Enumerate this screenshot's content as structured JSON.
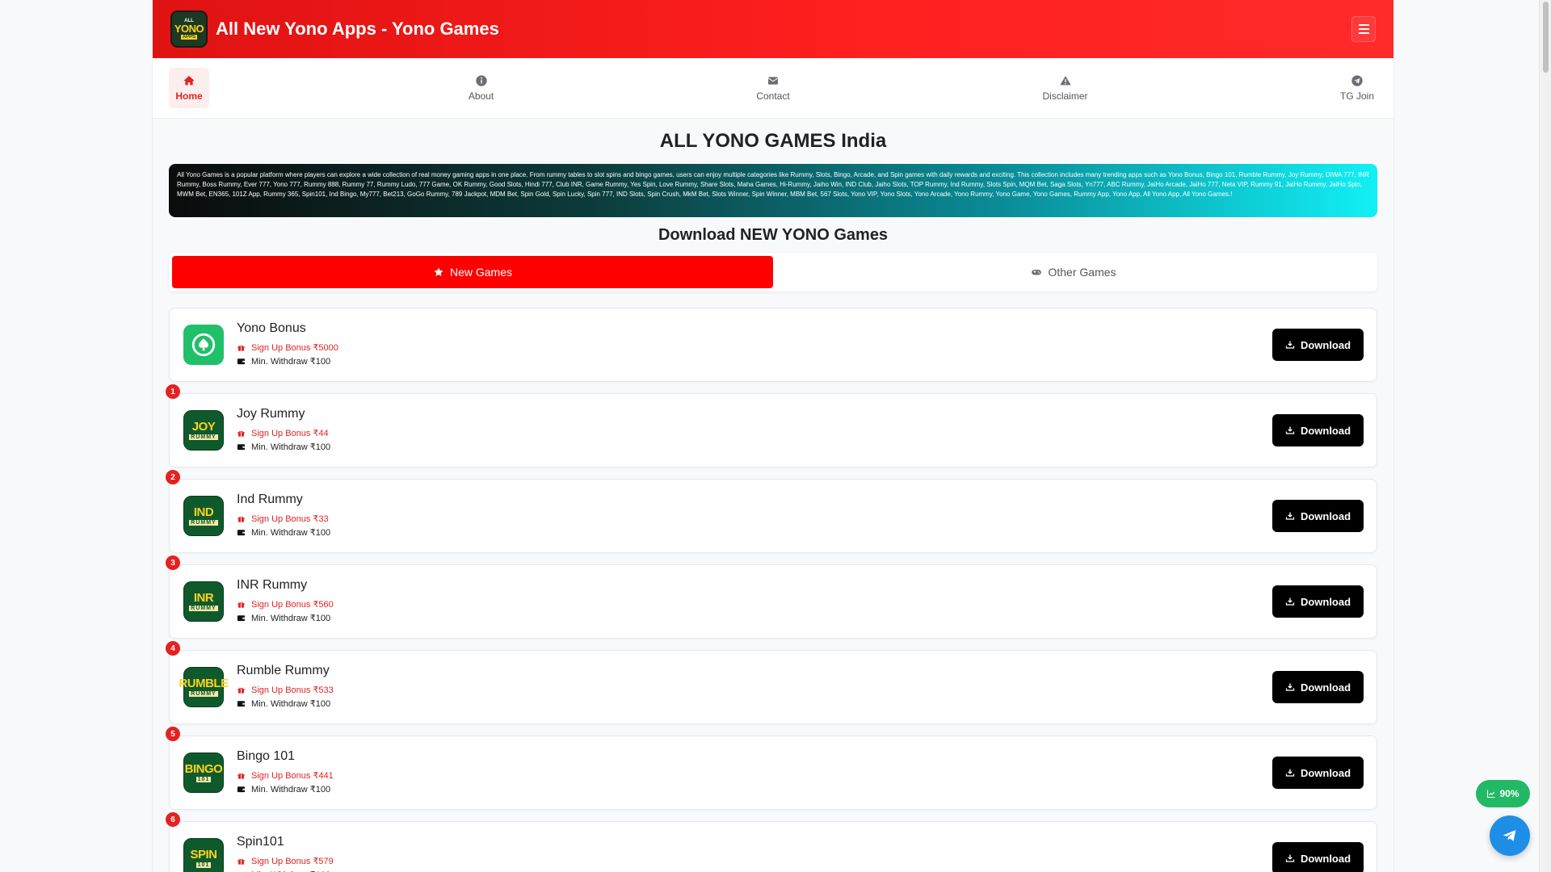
{
  "header": {
    "logo": {
      "top": "ALL",
      "mid": "YONO",
      "bottom": "APPS"
    },
    "title": "All New Yono Apps - Yono Games",
    "menu_icon": "hamburger-icon"
  },
  "nav": {
    "items": [
      {
        "label": "Home",
        "icon": "home-icon",
        "active": true
      },
      {
        "label": "About",
        "icon": "info-icon"
      },
      {
        "label": "Contact",
        "icon": "envelope-icon"
      },
      {
        "label": "Disclaimer",
        "icon": "warning-icon"
      },
      {
        "label": "TG Join",
        "icon": "telegram-icon"
      }
    ]
  },
  "main": {
    "heading": "ALL YONO GAMES India",
    "description": "All Yono Games is a popular platform where players can explore a wide collection of real money gaming apps in one place. From rummy tables to slot spins and bingo games, users can enjoy multiple categories like Rummy, Slots, Bingo, Arcade, and Spin games with daily rewards and exciting. This collection includes many trending apps such as Yono Bonus, Bingo 101, Rumble Rummy, Joy Rummy, DIWA 777, INR Rummy, Boss Rummy, Ever 777, Yono 777, Rummy 888, Rummy 77, Rummy Ludo, 777 Game, OK Rummy, Good Slots, Hindi 777, Club INR, Game Rummy, Yes Spin, Love Rummy, Share Slots, Maha Games, Hi-Rummy, Jaiho Win, IND Club, Jaiho Slots, TOP Rummy, Ind Rummy, Slots Spin, MQM Bet, Saga Slots, Yn777, ABC Rummy, JaiHo Arcade, JaiHo 777, Neta VIP, Rummy 91, JaiHo Rummy, JaiHo Spin, MWM Bet, EN365, 101Z App, Rummy 365, Spin101, Ind Bingo, My777, Bet213, GoGo Rummy, 789 Jackpot, MDM Bet, Spin Gold, Spin Lucky, Spin 777, IND Slots, Spin Crush, MkM Bet, Slots Winner, Spin Winner, MBM Bet, 567 Slots, Yono VIP, Yono Slots, Yono Arcade, Yono Rummy, Yono Game, Yono Games, Rummy App, Yono App, All Yono App, All Yono Games.!",
    "subheading": "Download NEW YONO Games",
    "tabs": [
      {
        "label": "New Games",
        "icon": "star-icon",
        "active": true
      },
      {
        "label": "Other Games",
        "icon": "gamepad-icon",
        "active": false
      }
    ],
    "download_label": "Download",
    "withdraw_label": "Min. Withdraw ₹100",
    "apps": [
      {
        "rank": "",
        "name": "Yono Bonus",
        "bonus": "Sign Up Bonus ₹5000",
        "icon_word": "",
        "icon_sub": ""
      },
      {
        "rank": "1",
        "name": "Joy Rummy",
        "bonus": "Sign Up Bonus ₹44",
        "icon_word": "JOY",
        "icon_sub": "RUMMY"
      },
      {
        "rank": "2",
        "name": "Ind Rummy",
        "bonus": "Sign Up Bonus ₹33",
        "icon_word": "IND",
        "icon_sub": "RUMMY"
      },
      {
        "rank": "3",
        "name": "INR Rummy",
        "bonus": "Sign Up Bonus ₹560",
        "icon_word": "INR",
        "icon_sub": "RUMMY"
      },
      {
        "rank": "4",
        "name": "Rumble Rummy",
        "bonus": "Sign Up Bonus ₹533",
        "icon_word": "RUMBLE",
        "icon_sub": "RUMMY"
      },
      {
        "rank": "5",
        "name": "Bingo 101",
        "bonus": "Sign Up Bonus ₹441",
        "icon_word": "BINGO",
        "icon_sub": "101"
      },
      {
        "rank": "6",
        "name": "Spin101",
        "bonus": "Sign Up Bonus ₹579",
        "icon_word": "SPIN",
        "icon_sub": "101"
      }
    ]
  },
  "floating": {
    "percent": "90%",
    "percent_icon": "chart-line-icon",
    "telegram_icon": "telegram-icon"
  },
  "colors": {
    "brand_red": "#ff1f1f",
    "download_bg": "#000000",
    "bonus_text": "#e02323",
    "badge_green": "#22b866",
    "telegram_blue": "#1f8ee6"
  }
}
